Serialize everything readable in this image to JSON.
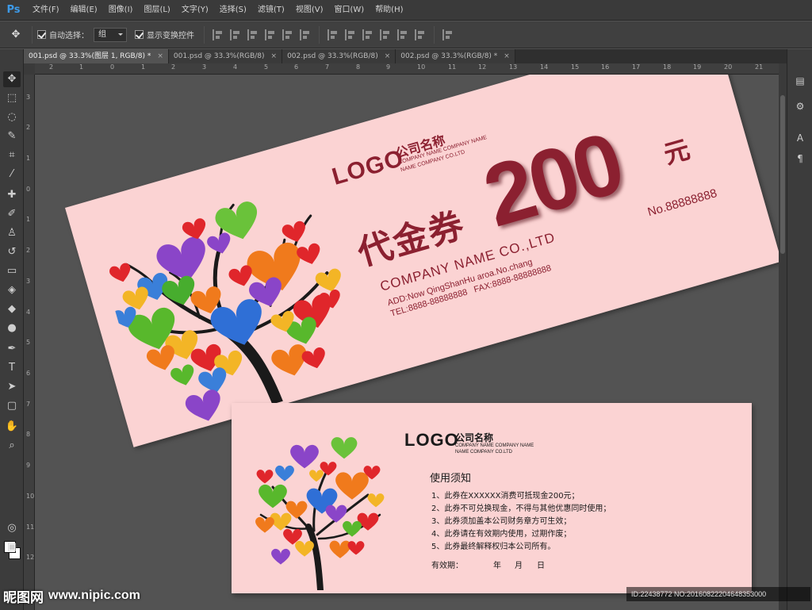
{
  "app": {
    "logo": "Ps"
  },
  "menu": [
    "文件(F)",
    "编辑(E)",
    "图像(I)",
    "图层(L)",
    "文字(Y)",
    "选择(S)",
    "滤镜(T)",
    "视图(V)",
    "窗口(W)",
    "帮助(H)"
  ],
  "options": {
    "tool_icon": "move-tool-icon",
    "auto_select_label": "自动选择：",
    "auto_select_checked": true,
    "auto_select_value": "组",
    "show_transform_label": "显示变换控件",
    "show_transform_checked": true
  },
  "tabs": [
    {
      "label": "001.psd @ 33.3%(图层 1, RGB/8) *",
      "active": true
    },
    {
      "label": "001.psd @ 33.3%(RGB/8)",
      "active": false
    },
    {
      "label": "002.psd @ 33.3%(RGB/8)",
      "active": false
    },
    {
      "label": "002.psd @ 33.3%(RGB/8) *",
      "active": false
    }
  ],
  "rulers": {
    "horizontal": [
      "2",
      "1",
      "0",
      "1",
      "2",
      "3",
      "4",
      "5",
      "6",
      "7",
      "8",
      "9",
      "10",
      "11",
      "12",
      "13",
      "14",
      "15",
      "16",
      "17",
      "18",
      "19",
      "20",
      "21"
    ],
    "vertical": [
      "3",
      "2",
      "1",
      "0",
      "1",
      "2",
      "3",
      "4",
      "5",
      "6",
      "7",
      "8",
      "9",
      "10",
      "11",
      "12"
    ]
  },
  "voucher_front": {
    "logo": "LOGO",
    "company_cn": "公司名称",
    "company_en_line1": "COMPANY NAME COMPANY NAME",
    "company_en_line2": "NAME COMPANY CO.LTD",
    "title": "代金券",
    "amount": "200",
    "unit": "元",
    "company_en": "COMPANY NAME CO.,LTD",
    "address": "ADD:Now QingShanHu aroa.No.chang",
    "tel": "TEL:8888-88888888 FAX:8888-88888888",
    "serial": "No.88888888"
  },
  "voucher_back": {
    "logo": "LOGO",
    "company_cn": "公司名称",
    "company_en_line1": "COMPANY NAME COMPANY NAME",
    "company_en_line2": "NAME COMPANY CO.LTD",
    "rules_title": "使用须知",
    "rules": [
      "1、此券在XXXXXX消费可抵现金200元；",
      "2、此券不可兑换现金，不得与其他优惠同时使用；",
      "3、此券须加盖本公司财务章方可生效；",
      "4、此券请在有效期内使用，过期作废；",
      "5、此券最终解释权归本公司所有。"
    ],
    "validity_label": "有效期：",
    "year": "年",
    "month": "月",
    "day": "日"
  },
  "watermark": {
    "brand": "昵图网",
    "site": "www.nipic.com",
    "id": "ID:22438772 NO:20160822204648353000"
  },
  "colors": {
    "accent": "#8b2030",
    "paper": "#fbd3d3",
    "ps_blue": "#3d9ae8"
  }
}
